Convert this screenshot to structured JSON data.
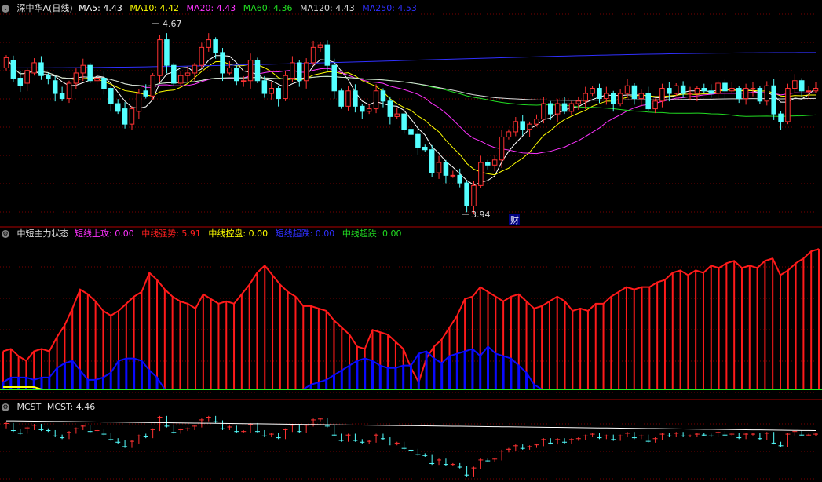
{
  "colors": {
    "background": "#000000",
    "grid": "#7a0000",
    "separator": "#b00000",
    "candle_up": "#ff3232",
    "candle_down": "#54ffff",
    "ma5": "#ffffff",
    "ma10": "#ffff00",
    "ma20": "#ff33ff",
    "ma60": "#22dd22",
    "ma120": "#dddddd",
    "ma250": "#3030ff",
    "status_red": "#ff1a1a",
    "status_blue": "#0a0aff",
    "status_green": "#22ee22",
    "status_yellow": "#ffff00",
    "mcst_line": "#ffffff"
  },
  "main_panel": {
    "title": "深中华A(日线)",
    "collapse_icon": "chevron-down-icon",
    "indicators": [
      {
        "label": "MA5: 4.43",
        "color": "#ffffff"
      },
      {
        "label": "MA10: 4.42",
        "color": "#ffff00"
      },
      {
        "label": "MA20: 4.43",
        "color": "#ff33ff"
      },
      {
        "label": "MA60: 4.36",
        "color": "#22dd22"
      },
      {
        "label": "MA120: 4.43",
        "color": "#dddddd"
      },
      {
        "label": "MA250: 4.53",
        "color": "#3030ff"
      }
    ],
    "high_marker": "4.67",
    "low_marker": "3.94",
    "finance_badge": "财"
  },
  "status_panel": {
    "title": "中短主力状态",
    "indicators": [
      {
        "label": "短线上攻: 0.00",
        "color": "#ff33ff"
      },
      {
        "label": "中线强势: 5.91",
        "color": "#ff2020"
      },
      {
        "label": "中线控盘: 0.00",
        "color": "#ffff00"
      },
      {
        "label": "短线超跌: 0.00",
        "color": "#3030ff"
      },
      {
        "label": "中线超跌: 0.00",
        "color": "#22dd22"
      }
    ]
  },
  "mcst_panel": {
    "title": "MCST",
    "indicators": [
      {
        "label": "MCST: 4.46",
        "color": "#e0e0e0"
      }
    ]
  },
  "chart_data": [
    {
      "type": "candlestick",
      "title": "深中华A(日线)",
      "y_range": [
        3.9,
        4.71
      ],
      "close": [
        4.54,
        4.46,
        4.43,
        4.49,
        4.52,
        4.47,
        4.46,
        4.4,
        4.38,
        4.44,
        4.48,
        4.51,
        4.45,
        4.46,
        4.42,
        4.36,
        4.33,
        4.28,
        4.34,
        4.4,
        4.39,
        4.47,
        4.61,
        4.51,
        4.44,
        4.47,
        4.48,
        4.51,
        4.58,
        4.61,
        4.56,
        4.48,
        4.5,
        4.45,
        4.45,
        4.53,
        4.45,
        4.4,
        4.42,
        4.38,
        4.47,
        4.52,
        4.45,
        4.52,
        4.58,
        4.59,
        4.51,
        4.41,
        4.35,
        4.41,
        4.35,
        4.33,
        4.34,
        4.41,
        4.37,
        4.31,
        4.32,
        4.26,
        4.24,
        4.19,
        4.18,
        4.09,
        4.13,
        4.08,
        4.08,
        4.05,
        3.96,
        4.04,
        4.13,
        4.12,
        4.14,
        4.23,
        4.25,
        4.29,
        4.26,
        4.28,
        4.3,
        4.36,
        4.32,
        4.36,
        4.33,
        4.36,
        4.37,
        4.4,
        4.42,
        4.38,
        4.4,
        4.36,
        4.4,
        4.43,
        4.38,
        4.4,
        4.34,
        4.37,
        4.42,
        4.4,
        4.43,
        4.4,
        4.4,
        4.42,
        4.41,
        4.4,
        4.44,
        4.41,
        4.42,
        4.38,
        4.42,
        4.42,
        4.37,
        4.43,
        4.32,
        4.29,
        4.42,
        4.45,
        4.41,
        4.41,
        4.42
      ],
      "open": [
        4.5,
        4.53,
        4.46,
        4.44,
        4.48,
        4.52,
        4.47,
        4.45,
        4.4,
        4.38,
        4.44,
        4.48,
        4.51,
        4.45,
        4.46,
        4.42,
        4.36,
        4.34,
        4.28,
        4.33,
        4.41,
        4.39,
        4.47,
        4.61,
        4.51,
        4.44,
        4.47,
        4.48,
        4.51,
        4.58,
        4.61,
        4.56,
        4.48,
        4.5,
        4.45,
        4.45,
        4.53,
        4.45,
        4.4,
        4.42,
        4.38,
        4.46,
        4.52,
        4.45,
        4.52,
        4.58,
        4.59,
        4.51,
        4.41,
        4.35,
        4.41,
        4.35,
        4.33,
        4.34,
        4.41,
        4.37,
        4.31,
        4.32,
        4.26,
        4.24,
        4.19,
        4.18,
        4.09,
        4.13,
        4.08,
        4.08,
        4.05,
        3.96,
        4.04,
        4.13,
        4.12,
        4.14,
        4.23,
        4.25,
        4.29,
        4.26,
        4.28,
        4.3,
        4.36,
        4.32,
        4.36,
        4.33,
        4.36,
        4.37,
        4.4,
        4.42,
        4.38,
        4.4,
        4.36,
        4.4,
        4.43,
        4.38,
        4.4,
        4.34,
        4.37,
        4.42,
        4.4,
        4.43,
        4.4,
        4.4,
        4.42,
        4.41,
        4.4,
        4.44,
        4.41,
        4.42,
        4.38,
        4.42,
        4.42,
        4.37,
        4.43,
        4.32,
        4.29,
        4.42,
        4.45,
        4.41,
        4.41
      ],
      "series": [
        {
          "name": "MA5",
          "last": 4.43
        },
        {
          "name": "MA10",
          "last": 4.42
        },
        {
          "name": "MA20",
          "last": 4.43
        },
        {
          "name": "MA60",
          "last": 4.36
        },
        {
          "name": "MA120",
          "last": 4.43
        },
        {
          "name": "MA250",
          "last": 4.53
        }
      ],
      "annotations": [
        "4.67",
        "3.94",
        "财"
      ]
    },
    {
      "type": "bar",
      "title": "中短主力状态",
      "y_range": [
        -0.5,
        6.3
      ],
      "series": [
        {
          "name": "中线强势",
          "values": [
            1.6,
            1.7,
            1.4,
            1.2,
            1.6,
            1.7,
            1.6,
            2.2,
            2.7,
            3.4,
            4.2,
            4.0,
            3.7,
            3.3,
            3.1,
            3.3,
            3.6,
            3.9,
            4.1,
            4.9,
            4.6,
            4.2,
            3.9,
            3.7,
            3.6,
            3.4,
            4.0,
            3.8,
            3.6,
            3.7,
            3.6,
            4.0,
            4.4,
            4.9,
            5.2,
            4.8,
            4.4,
            4.1,
            3.9,
            3.5,
            3.5,
            3.4,
            3.3,
            2.9,
            2.6,
            2.3,
            1.8,
            1.7,
            2.5,
            2.4,
            2.3,
            2.0,
            1.7,
            0.9,
            0.3,
            1.3,
            1.8,
            2.1,
            2.6,
            3.1,
            3.8,
            3.9,
            4.3,
            4.1,
            3.9,
            3.7,
            3.9,
            4.0,
            3.7,
            3.4,
            3.5,
            3.7,
            3.9,
            3.7,
            3.3,
            3.4,
            3.3,
            3.6,
            3.6,
            3.9,
            4.1,
            4.3,
            4.2,
            4.3,
            4.3,
            4.5,
            4.6,
            4.9,
            5.0,
            4.8,
            5.0,
            4.9,
            5.2,
            5.1,
            5.3,
            5.4,
            5.1,
            5.2,
            5.1,
            5.4,
            5.5,
            4.8,
            5.0,
            5.3,
            5.5,
            5.8,
            5.9
          ]
        },
        {
          "name": "短线超跌",
          "values": [
            0.3,
            0.5,
            0.5,
            0.5,
            0.4,
            0.5,
            0.5,
            0.9,
            1.1,
            1.2,
            0.8,
            0.4,
            0.4,
            0.5,
            0.7,
            1.2,
            1.3,
            1.3,
            1.2,
            0.8,
            0.5,
            0,
            0,
            0,
            0,
            0,
            0,
            0,
            0,
            0,
            0,
            0,
            0,
            0,
            0,
            0,
            0,
            0,
            0,
            0,
            0.2,
            0.3,
            0.4,
            0.6,
            0.8,
            1.0,
            1.2,
            1.3,
            1.2,
            1.0,
            0.9,
            0.9,
            1.0,
            1.0,
            1.5,
            1.6,
            1.3,
            1.1,
            1.4,
            1.5,
            1.6,
            1.7,
            1.4,
            1.8,
            1.5,
            1.4,
            1.3,
            1.0,
            0.7,
            0.2,
            0,
            0,
            0,
            0,
            0,
            0,
            0,
            0,
            0,
            0,
            0,
            0,
            0,
            0,
            0,
            0,
            0,
            0,
            0,
            0,
            0,
            0,
            0,
            0,
            0,
            0,
            0,
            0,
            0,
            0,
            0,
            0,
            0,
            0,
            0,
            0,
            0,
            0
          ]
        },
        {
          "name": "中线控盘",
          "values": [
            0.1,
            0.1,
            0.1,
            0.1,
            0.1,
            0,
            0,
            0,
            0,
            0,
            0,
            0,
            0,
            0,
            0,
            0,
            0,
            0,
            0,
            0,
            0,
            0,
            0,
            0,
            0,
            0,
            0,
            0,
            0,
            0,
            0,
            0,
            0,
            0,
            0,
            0,
            0,
            0,
            0,
            0,
            0,
            0,
            0,
            0,
            0,
            0,
            0,
            0,
            0,
            0,
            0,
            0,
            0,
            0,
            0,
            0,
            0,
            0,
            0,
            0,
            0,
            0,
            0,
            0,
            0,
            0,
            0,
            0,
            0,
            0,
            0,
            0,
            0,
            0,
            0,
            0,
            0,
            0,
            0,
            0,
            0,
            0,
            0,
            0,
            0,
            0,
            0,
            0,
            0,
            0,
            0,
            0,
            0,
            0,
            0,
            0,
            0,
            0,
            0,
            0,
            0,
            0,
            0,
            0,
            0,
            0,
            0,
            0,
            0,
            0
          ]
        },
        {
          "name": "中线超跌",
          "values": [
            0,
            0,
            0,
            0,
            0,
            0,
            0,
            0,
            0,
            0,
            0,
            0,
            0,
            0,
            0,
            0,
            0,
            0,
            0,
            0,
            0,
            0,
            0,
            0,
            0,
            0,
            0,
            0,
            0,
            0,
            0,
            0,
            0,
            0,
            0,
            0,
            0,
            0,
            0,
            0,
            0,
            0,
            0,
            0,
            0,
            0,
            0,
            0,
            0,
            0,
            0,
            0,
            0,
            0,
            0,
            0,
            0,
            0,
            0,
            0,
            0,
            0,
            0,
            0.1,
            0.1,
            0.1,
            0.1,
            0.1,
            0.1,
            0,
            0,
            0,
            0,
            0,
            0,
            0,
            0,
            0,
            0,
            0,
            0,
            0,
            0,
            0,
            0,
            0,
            0,
            0,
            0,
            0,
            0,
            0,
            0,
            0,
            0,
            0,
            0,
            0,
            0,
            0,
            0,
            0,
            0,
            0,
            0,
            0,
            0,
            0,
            0,
            0
          ]
        }
      ]
    },
    {
      "type": "line",
      "title": "MCST",
      "y_range": [
        3.9,
        4.65
      ],
      "series": [
        {
          "name": "MCST",
          "last": 4.46
        }
      ]
    }
  ]
}
